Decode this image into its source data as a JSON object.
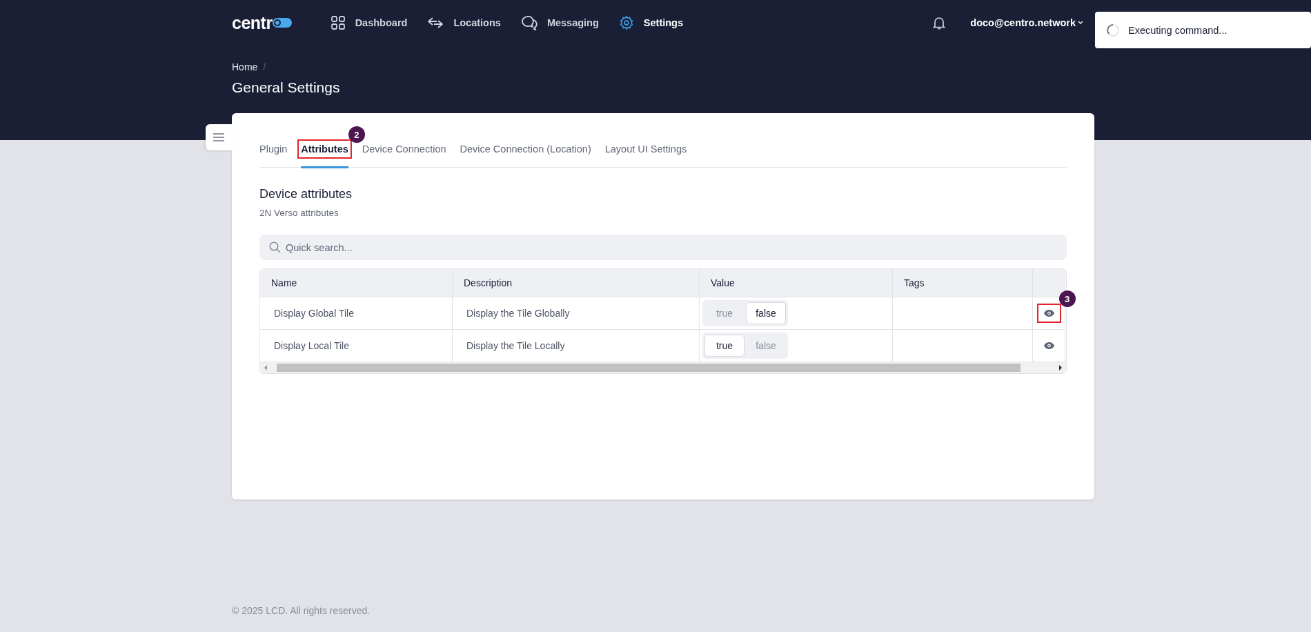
{
  "header": {
    "brand": "centr",
    "nav": [
      {
        "label": "Dashboard",
        "selected": false
      },
      {
        "label": "Locations",
        "selected": false
      },
      {
        "label": "Messaging",
        "selected": false
      },
      {
        "label": "Settings",
        "selected": true
      }
    ],
    "user": "doco@centro.network"
  },
  "toast": {
    "message": "Executing command..."
  },
  "breadcrumb": {
    "items": [
      "Home"
    ],
    "separator": "/"
  },
  "page_title": "General Settings",
  "tabs": [
    {
      "label": "Plugin",
      "selected": false
    },
    {
      "label": "Attributes",
      "selected": true,
      "callout": "2"
    },
    {
      "label": "Device Connection",
      "selected": false
    },
    {
      "label": "Device Connection (Location)",
      "selected": false
    },
    {
      "label": "Layout UI Settings",
      "selected": false
    }
  ],
  "section": {
    "title": "Device attributes",
    "subtitle": "2N Verso attributes"
  },
  "search": {
    "placeholder": "Quick search..."
  },
  "table": {
    "columns": [
      "Name",
      "Description",
      "Value",
      "Tags"
    ],
    "rows": [
      {
        "name": "Display Global Tile",
        "description": "Display the Tile Globally",
        "options": [
          {
            "label": "true",
            "selected": false
          },
          {
            "label": "false",
            "selected": true
          }
        ],
        "callout": "3"
      },
      {
        "name": "Display Local Tile",
        "description": "Display the Tile Locally",
        "options": [
          {
            "label": "true",
            "selected": true
          },
          {
            "label": "false",
            "selected": false
          }
        ]
      }
    ]
  },
  "footer": "© 2025 LCD. All rights reserved."
}
